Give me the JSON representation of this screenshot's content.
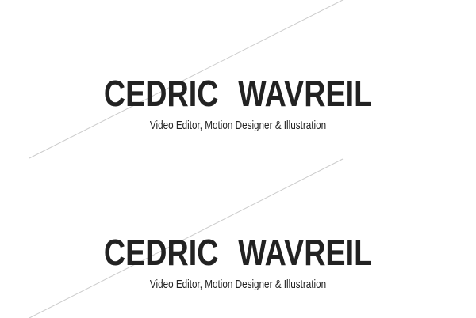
{
  "logos": [
    {
      "first_name": "CEDRIC",
      "last_name": "WAVREIL",
      "tagline": "Video Editor, Motion Designer & Illustration"
    },
    {
      "first_name": "CEDRIC",
      "last_name": "WAVREIL",
      "tagline": "Video Editor, Motion Designer & Illustration"
    }
  ],
  "colors": {
    "background": "#ffffff",
    "text": "#222222",
    "line": "#cccccc"
  }
}
